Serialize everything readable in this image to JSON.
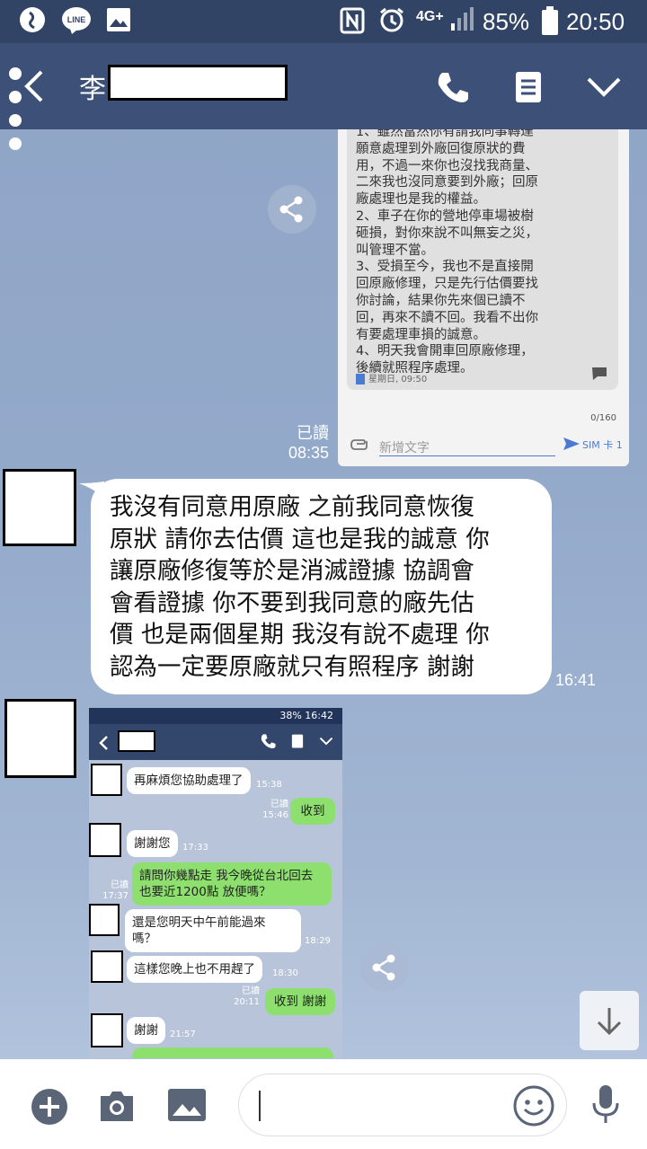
{
  "status_bar": {
    "battery": "85%",
    "time": "20:50",
    "network": "4G+"
  },
  "header": {
    "contact_name": "李"
  },
  "sms_screenshot": {
    "text": "1、雖然當然你有請我同事轉達\n願意處理到外廠回復原狀的費\n用，不過一來你也沒找我商量、\n二來我也沒同意要到外廠；回原\n廠處理也是我的權益。\n2、車子在你的營地停車場被樹\n砸損，對你來說不叫無妄之災，\n叫管理不當。\n3、受損至今，我也不是直接開\n回原廠修理，只是先行估價要找\n你討論，結果你先來個已讀不\n回，再來不讀不回。我看不出你\n有要處理車損的誠意。\n4、明天我會開車回原廠修理，\n後續就照程序處理。",
    "timestamp": "星期日, 09:50",
    "char_count": "0/160",
    "input_placeholder": "新增文字",
    "send_label": "SIM 卡 1"
  },
  "sent_meta": {
    "read_label": "已讀",
    "time": "08:35"
  },
  "incoming_message": {
    "text": "我沒有同意用原廠 之前我同意恢復\n原狀 請你去估價 這也是我的誠意 你\n讓原廠修復等於是消滅證據 協調會\n會看證據 你不要到我同意的廠先估\n價 也是兩個星期 我沒有說不處理 你\n認為一定要原廠就只有照程序 謝謝",
    "time": "16:41"
  },
  "chat_screenshot": {
    "status_text": "38% 16:42",
    "messages": [
      {
        "dir": "in",
        "text": "再麻煩您協助處理了",
        "time": "15:38"
      },
      {
        "dir": "out",
        "text": "收到",
        "read": "已讀",
        "time": "15:46"
      },
      {
        "dir": "in",
        "text": "謝謝您",
        "time": "17:33"
      },
      {
        "dir": "out",
        "text": "請問你幾點走 我今晚從台北回去\n也要近1200點 放便嗎？",
        "read": "已讀",
        "time": "17:37"
      },
      {
        "dir": "in",
        "text": "還是您明天中午前能過來\n嗎？",
        "time": "18:29"
      },
      {
        "dir": "in",
        "text": "這樣您晚上也不用趕了",
        "time": "18:30"
      },
      {
        "dir": "out",
        "text": "收到 謝謝",
        "read": "已讀",
        "time": "20:11"
      },
      {
        "dir": "in",
        "text": "謝謝",
        "time": "21:57"
      }
    ]
  },
  "colors": {
    "header_bg": "#3d5178",
    "status_bg": "#324466",
    "bubble_in": "#ffffff",
    "bubble_out": "#8de06e"
  }
}
